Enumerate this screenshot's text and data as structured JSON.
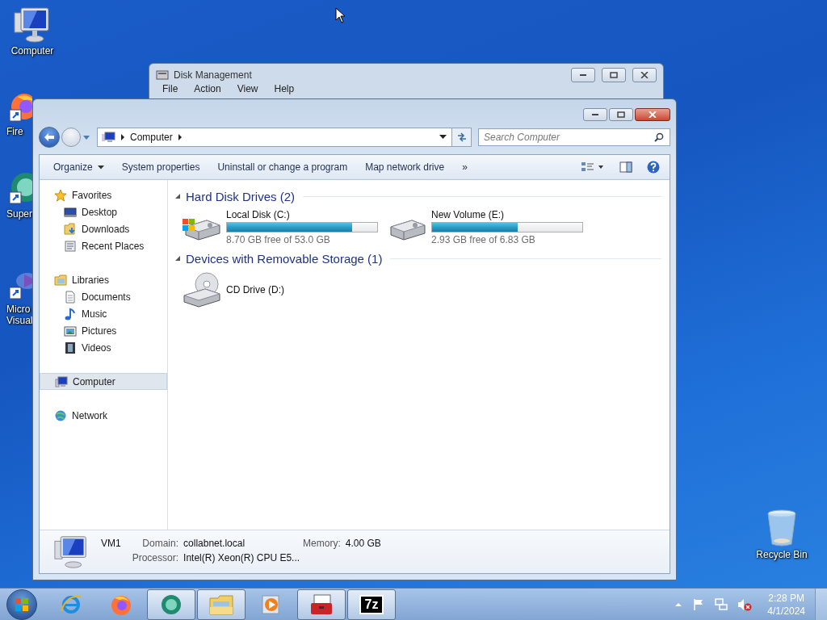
{
  "desktop_icons": [
    {
      "kind": "computer",
      "lines": [
        "Computer"
      ]
    },
    {
      "kind": "firefox",
      "lines": [
        "Fire"
      ]
    },
    {
      "kind": "app",
      "lines": [
        "Super"
      ]
    },
    {
      "kind": "vs",
      "lines": [
        "Micro",
        "Visual"
      ]
    },
    {
      "kind": "recycle",
      "lines": [
        "Recycle Bin"
      ]
    }
  ],
  "back_window": {
    "title": "Disk Management",
    "menu": [
      "File",
      "Action",
      "View",
      "Help"
    ]
  },
  "explorer": {
    "address": {
      "crumbs": [
        "Computer"
      ]
    },
    "search": {
      "placeholder": "Search Computer"
    },
    "toolbar": [
      {
        "label": "Organize",
        "kind": "menu"
      },
      {
        "label": "System properties",
        "kind": "command"
      },
      {
        "label": "Uninstall or change a program",
        "kind": "command"
      },
      {
        "label": "Map network drive",
        "kind": "command"
      },
      {
        "label": "»",
        "kind": "overflow"
      }
    ],
    "nav": [
      {
        "label": "Favorites",
        "kind": "star",
        "selected": false,
        "children": [
          {
            "label": "Desktop",
            "kind": "desktop",
            "selected": false
          },
          {
            "label": "Downloads",
            "kind": "downloads",
            "selected": false
          },
          {
            "label": "Recent Places",
            "kind": "recent",
            "selected": false
          }
        ]
      },
      {
        "label": "Libraries",
        "kind": "library",
        "selected": false,
        "children": [
          {
            "label": "Documents",
            "kind": "documents",
            "selected": false
          },
          {
            "label": "Music",
            "kind": "music",
            "selected": false
          },
          {
            "label": "Pictures",
            "kind": "pictures",
            "selected": false
          },
          {
            "label": "Videos",
            "kind": "videos",
            "selected": false
          }
        ]
      },
      {
        "label": "Computer",
        "kind": "computer",
        "selected": true
      },
      {
        "label": "Network",
        "kind": "network",
        "selected": false
      }
    ],
    "groups": [
      {
        "title": "Hard Disk Drives (2)",
        "expanded": true,
        "items": [
          {
            "name": "Local Disk (C:)",
            "kind": "system-disk",
            "level": 0.836,
            "space": "8.70 GB free of 53.0 GB"
          },
          {
            "name": "New Volume (E:)",
            "kind": "disk",
            "level": 0.571,
            "space": "2.93 GB free of 6.83 GB"
          }
        ]
      },
      {
        "title": "Devices with Removable Storage (1)",
        "expanded": true,
        "items": [
          {
            "name": "CD Drive (D:)",
            "kind": "cd"
          }
        ]
      }
    ],
    "details": {
      "name": "VM1",
      "fields": [
        {
          "label": "Domain:",
          "value": "collabnet.local"
        },
        {
          "label": "Memory:",
          "value": "4.00 GB"
        },
        {
          "label": "Processor:",
          "value": "Intel(R) Xeon(R) CPU E5..."
        }
      ]
    }
  },
  "taskbar": {
    "items": [
      {
        "kind": "ie",
        "active": false
      },
      {
        "kind": "firefox",
        "active": false
      },
      {
        "kind": "app",
        "active": true
      },
      {
        "kind": "explorer",
        "active": true
      },
      {
        "kind": "media",
        "active": false
      },
      {
        "kind": "toolbox",
        "active": true
      },
      {
        "kind": "sevenzip",
        "active": true,
        "text": "7z"
      }
    ],
    "tray": [
      {
        "kind": "chevron"
      },
      {
        "kind": "flag"
      },
      {
        "kind": "network"
      },
      {
        "kind": "volume",
        "muted": true
      }
    ],
    "time": "2:28 PM",
    "date": "4/1/2024"
  }
}
